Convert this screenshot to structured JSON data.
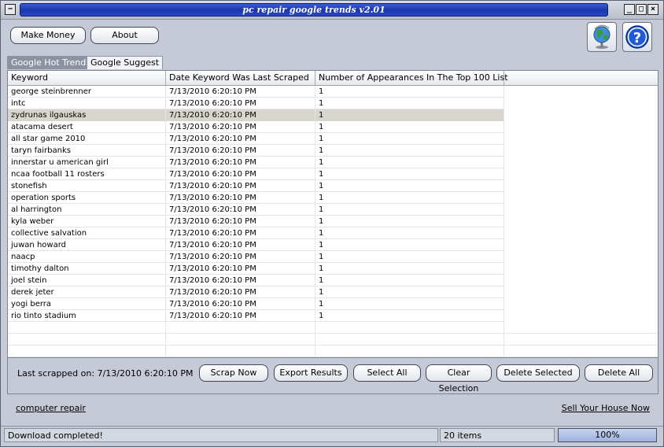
{
  "window": {
    "title": "pc repair google trends v2.01"
  },
  "toolbar": {
    "make_money_label": "Make Money",
    "about_label": "About"
  },
  "tabs": [
    {
      "label": "Google Hot Trends",
      "active": true
    },
    {
      "label": "Google Suggest",
      "active": false
    }
  ],
  "table": {
    "columns": [
      "Keyword",
      "Date Keyword Was Last Scraped",
      "Number of Appearances In The Top 100 List",
      ""
    ],
    "selected_index": 2,
    "rows": [
      {
        "keyword": "george steinbrenner",
        "date": "7/13/2010 6:20:10 PM",
        "count": "1"
      },
      {
        "keyword": "intc",
        "date": "7/13/2010 6:20:10 PM",
        "count": "1"
      },
      {
        "keyword": "zydrunas ilgauskas",
        "date": "7/13/2010 6:20:10 PM",
        "count": "1"
      },
      {
        "keyword": "atacama desert",
        "date": "7/13/2010 6:20:10 PM",
        "count": "1"
      },
      {
        "keyword": "all star game 2010",
        "date": "7/13/2010 6:20:10 PM",
        "count": "1"
      },
      {
        "keyword": "taryn fairbanks",
        "date": "7/13/2010 6:20:10 PM",
        "count": "1"
      },
      {
        "keyword": "innerstar u american girl",
        "date": "7/13/2010 6:20:10 PM",
        "count": "1"
      },
      {
        "keyword": "ncaa football 11 rosters",
        "date": "7/13/2010 6:20:10 PM",
        "count": "1"
      },
      {
        "keyword": "stonefish",
        "date": "7/13/2010 6:20:10 PM",
        "count": "1"
      },
      {
        "keyword": "operation sports",
        "date": "7/13/2010 6:20:10 PM",
        "count": "1"
      },
      {
        "keyword": "al harrington",
        "date": "7/13/2010 6:20:10 PM",
        "count": "1"
      },
      {
        "keyword": "kyla weber",
        "date": "7/13/2010 6:20:10 PM",
        "count": "1"
      },
      {
        "keyword": "collective salvation",
        "date": "7/13/2010 6:20:10 PM",
        "count": "1"
      },
      {
        "keyword": "juwan howard",
        "date": "7/13/2010 6:20:10 PM",
        "count": "1"
      },
      {
        "keyword": "naacp",
        "date": "7/13/2010 6:20:10 PM",
        "count": "1"
      },
      {
        "keyword": "timothy dalton",
        "date": "7/13/2010 6:20:10 PM",
        "count": "1"
      },
      {
        "keyword": "joel stein",
        "date": "7/13/2010 6:20:10 PM",
        "count": "1"
      },
      {
        "keyword": "derek jeter",
        "date": "7/13/2010 6:20:10 PM",
        "count": "1"
      },
      {
        "keyword": "yogi berra",
        "date": "7/13/2010 6:20:10 PM",
        "count": "1"
      },
      {
        "keyword": "rio tinto stadium",
        "date": "7/13/2010 6:20:10 PM",
        "count": "1"
      }
    ],
    "empty_rows": 3
  },
  "actions": {
    "last_scraped": "Last scrapped on: 7/13/2010 6:20:10 PM",
    "scrap_now": "Scrap Now",
    "export_results": "Export Results",
    "select_all": "Select All",
    "clear_selection": "Clear Selection",
    "delete_selected": "Delete Selected",
    "delete_all": "Delete All"
  },
  "links": {
    "computer_repair": "computer repair",
    "sell_house": "Sell Your House Now"
  },
  "status": {
    "message": "Download completed!",
    "items": "20 items",
    "progress_label": "100%",
    "progress_fraction": 1.0
  },
  "colors": {
    "title_blue": "#1b36a8",
    "selected_row": "#d8d5cf",
    "window_bg": "#c5cad6"
  }
}
